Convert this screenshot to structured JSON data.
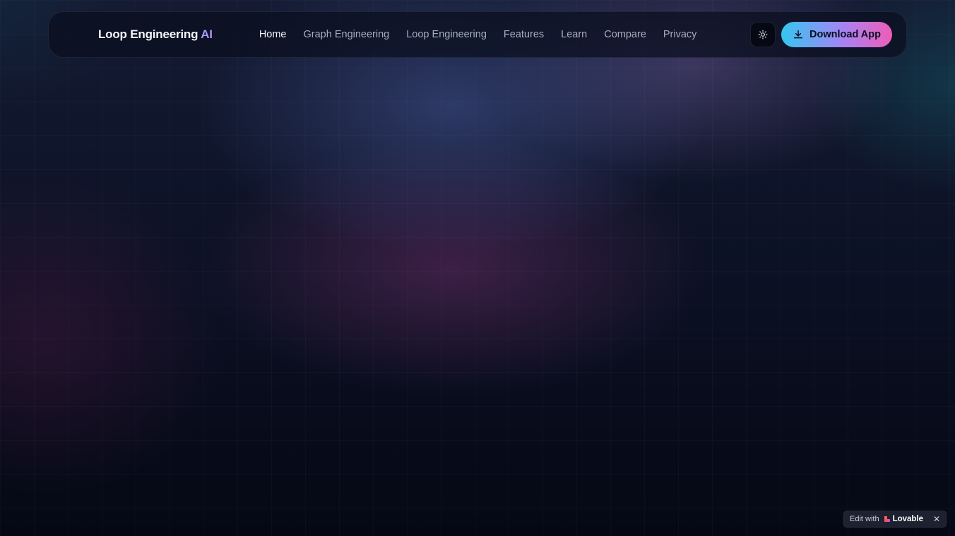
{
  "brand": {
    "name": "Loop Engineering",
    "accent": "AI"
  },
  "nav": {
    "items": [
      {
        "label": "Home",
        "active": true
      },
      {
        "label": "Graph Engineering",
        "active": false
      },
      {
        "label": "Loop Engineering",
        "active": false
      },
      {
        "label": "Features",
        "active": false
      },
      {
        "label": "Learn",
        "active": false
      },
      {
        "label": "Compare",
        "active": false
      },
      {
        "label": "Privacy",
        "active": false
      }
    ]
  },
  "actions": {
    "theme_icon": "sun-icon",
    "download_label": "Download App",
    "download_icon": "download-icon"
  },
  "badge": {
    "prefix": "Edit with",
    "brand": "Lovable",
    "close_icon": "close-icon"
  },
  "colors": {
    "button_gradient_start": "#35c6f0",
    "button_gradient_mid": "#a584f4",
    "button_gradient_end": "#ef5db7",
    "background": "#060a17",
    "lovable_mark": "#ff4d5e"
  }
}
